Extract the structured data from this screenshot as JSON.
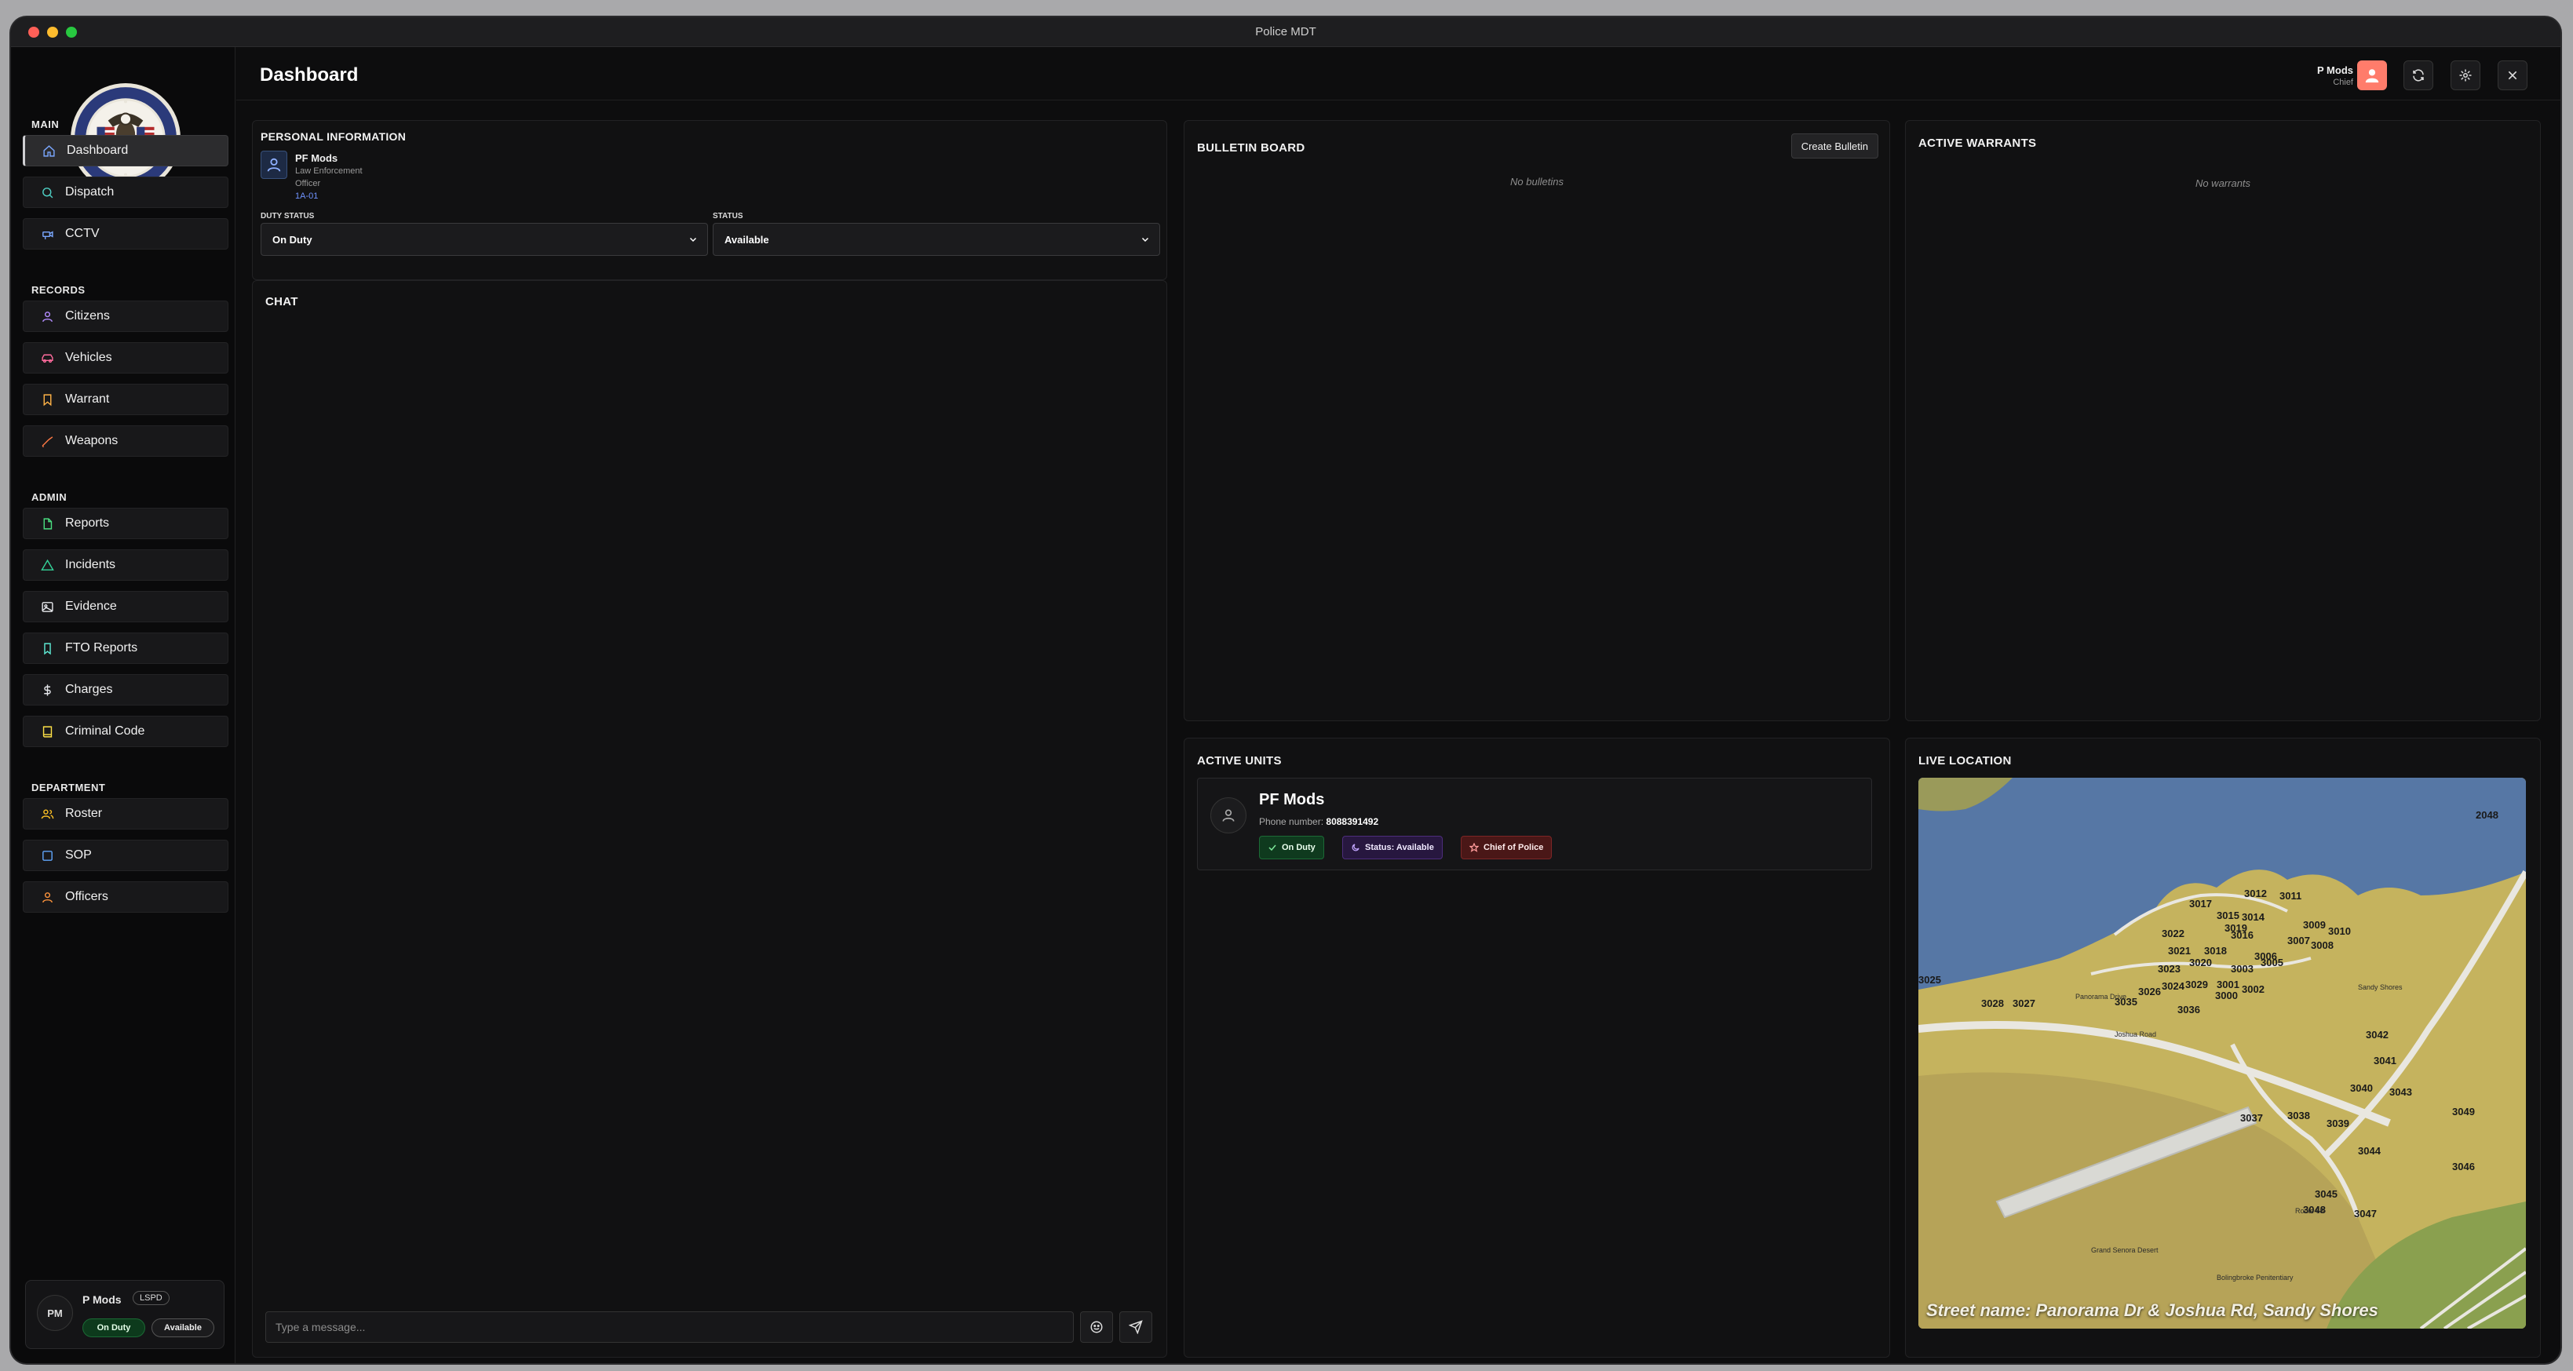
{
  "window": {
    "title": "Police MDT"
  },
  "sidebar": {
    "sections": [
      {
        "heading": "MAIN",
        "items": [
          "Dashboard",
          "Dispatch",
          "CCTV"
        ]
      },
      {
        "heading": "RECORDS",
        "items": [
          "Citizens",
          "Vehicles",
          "Warrant",
          "Weapons"
        ]
      },
      {
        "heading": "ADMIN",
        "items": [
          "Reports",
          "Incidents",
          "Evidence",
          "FTO Reports",
          "Charges",
          "Criminal Code"
        ]
      },
      {
        "heading": "DEPARTMENT",
        "items": [
          "Roster",
          "SOP",
          "Officers"
        ]
      }
    ],
    "active_item": "Dashboard",
    "user": {
      "initials": "PM",
      "name": "P Mods",
      "department": "LSPD",
      "duty": "On Duty",
      "status": "Available"
    }
  },
  "header": {
    "title": "Dashboard",
    "user_name": "P Mods",
    "user_rank": "Chief",
    "accent_color": "#ff7c6b"
  },
  "personal_info": {
    "title": "PERSONAL INFORMATION",
    "name": "PF Mods",
    "department": "Law Enforcement",
    "rank": "Officer",
    "callsign": "1A-01",
    "duty_label": "DUTY STATUS",
    "duty_value": "On Duty",
    "status_label": "STATUS",
    "status_value": "Available"
  },
  "chat": {
    "title": "CHAT",
    "placeholder": "Type a message..."
  },
  "bulletin": {
    "title": "BULLETIN BOARD",
    "create_label": "Create Bulletin",
    "empty": "No bulletins"
  },
  "warrants": {
    "title": "ACTIVE WARRANTS",
    "empty": "No warrants"
  },
  "units": {
    "title": "ACTIVE UNITS",
    "unit": {
      "name": "PF Mods",
      "phone_label": "Phone number:",
      "phone": "8088391492",
      "duty": "On Duty",
      "status": "Status: Available",
      "rank": "Chief of Police"
    }
  },
  "live_location": {
    "title": "LIVE LOCATION",
    "street": "Street name: Panorama Dr & Joshua Rd, Sandy Shores",
    "map_labels": [
      "2048",
      "3017",
      "3012",
      "3011",
      "3019",
      "3015",
      "3014",
      "3022",
      "3016",
      "3009",
      "3010",
      "3021",
      "3018",
      "3007",
      "3008",
      "3020",
      "3006",
      "3023",
      "3003",
      "3005",
      "3025",
      "3029",
      "3024",
      "3001",
      "3002",
      "3026",
      "3028",
      "3027",
      "3035",
      "3000",
      "3036",
      "3042",
      "3041",
      "3040",
      "3043",
      "3049",
      "3037",
      "3038",
      "3039",
      "3044",
      "3046",
      "3045",
      "3048",
      "3047"
    ],
    "map_text": [
      "Joshua Road",
      "Panorama Drive",
      "Grand Senora Desert",
      "Bolingbroke Penitentiary",
      "Sandy Shores",
      "Route 68"
    ]
  },
  "colors": {
    "background": "#0d0d0e",
    "panel": "#111112",
    "on_duty": "#0f3a1e",
    "status": "#27173f",
    "chief": "#4a1717",
    "map_water": "#5677a5",
    "map_land": "#c5b35e"
  }
}
